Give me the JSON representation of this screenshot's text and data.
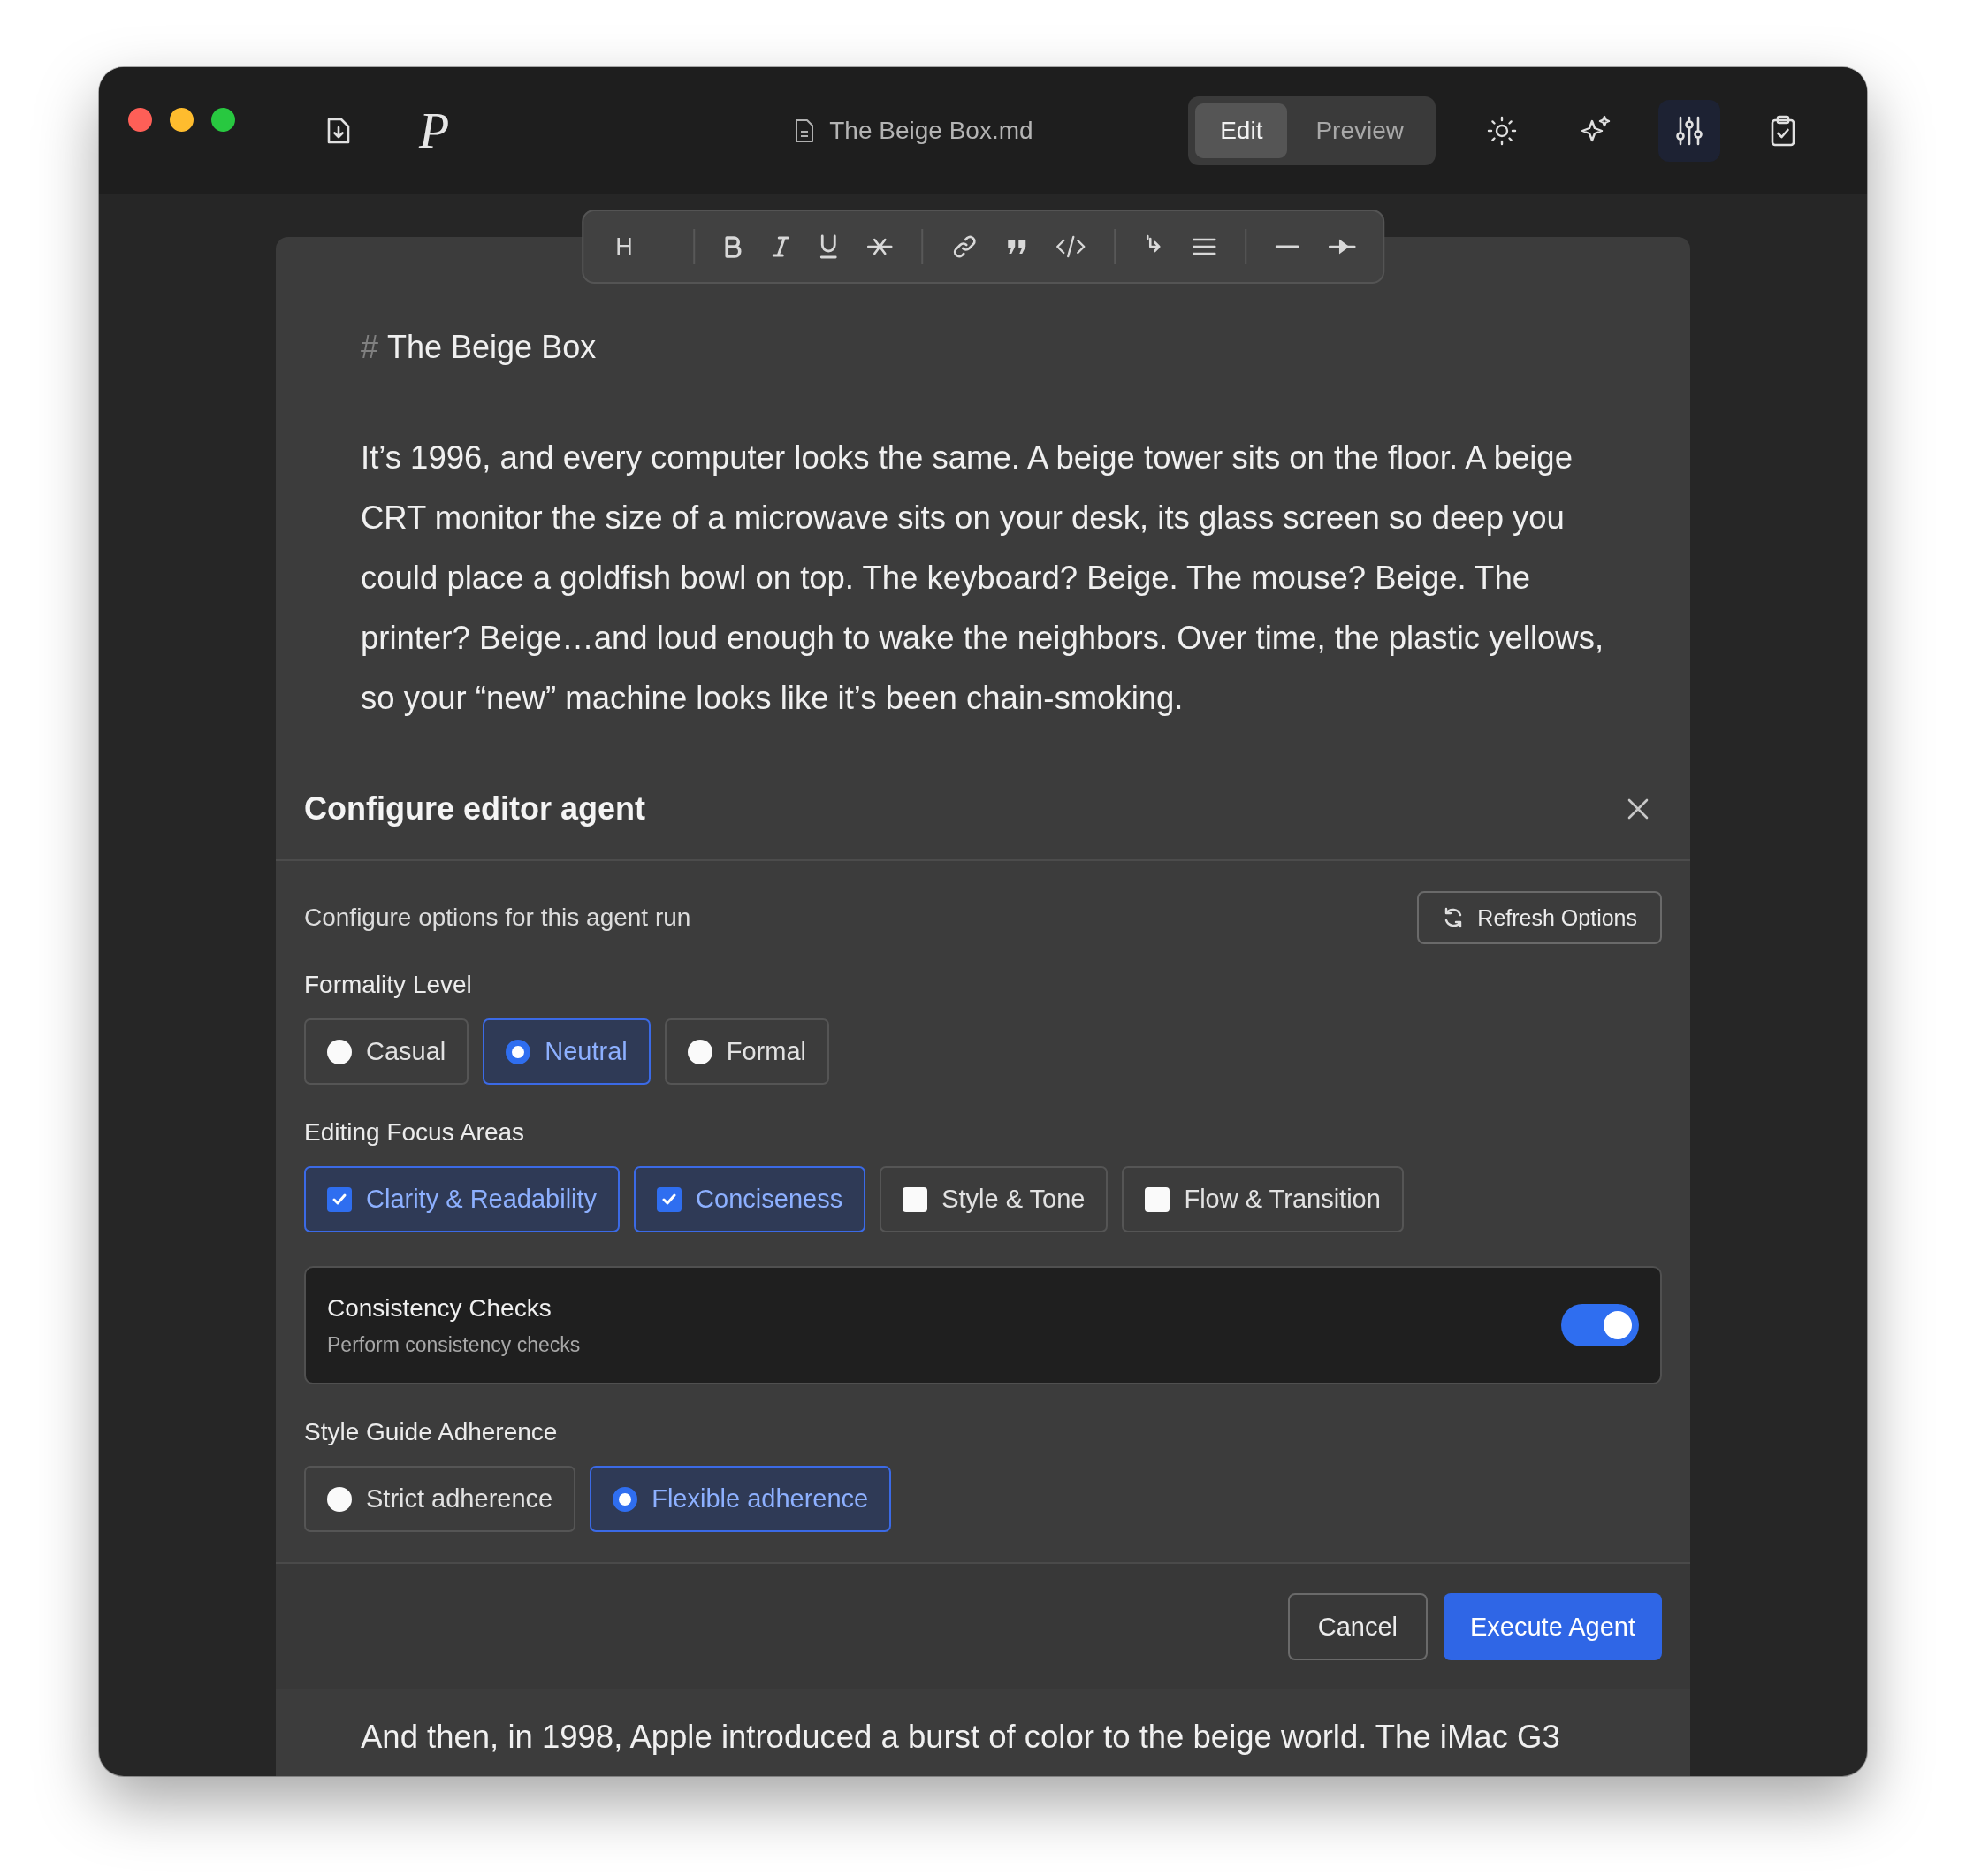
{
  "titlebar": {
    "logo": "P",
    "document_title": "The Beige Box.md",
    "modes": [
      {
        "label": "Edit",
        "selected": true
      },
      {
        "label": "Preview",
        "selected": false
      }
    ],
    "tools": [
      {
        "kind": "theme",
        "active": false
      },
      {
        "kind": "sparkle",
        "active": false
      },
      {
        "kind": "sliders",
        "active": true
      },
      {
        "kind": "clipboard",
        "active": false
      }
    ]
  },
  "format_toolbar": {
    "heading": "H"
  },
  "document": {
    "heading_marker": "#",
    "heading": "The Beige Box",
    "paragraph": "It’s 1996, and every computer looks the same. A beige tower sits on the floor. A beige CRT monitor the size of a microwave sits on your desk, its glass screen so deep you could place a goldfish bowl on top. The keyboard? Beige. The mouse? Beige. The printer? Beige…and loud enough to wake the neighbors. Over time, the plastic yellows, so your “new” machine looks like it’s been chain-smoking.",
    "next_paragraph": "And then, in 1998, Apple introduced a burst of color to the beige world. The iMac G3"
  },
  "dialog": {
    "title": "Configure editor agent",
    "description": "Configure options for this agent run",
    "refresh_button": "Refresh Options",
    "sections": [
      {
        "kind": "radio",
        "label": "Formality Level",
        "options": [
          {
            "label": "Casual",
            "selected": false
          },
          {
            "label": "Neutral",
            "selected": true
          },
          {
            "label": "Formal",
            "selected": false
          }
        ]
      },
      {
        "kind": "checkbox",
        "label": "Editing Focus Areas",
        "options": [
          {
            "label": "Clarity & Readability",
            "checked": true
          },
          {
            "label": "Conciseness",
            "checked": true
          },
          {
            "label": "Style & Tone",
            "checked": false
          },
          {
            "label": "Flow & Transition",
            "checked": false
          }
        ]
      },
      {
        "kind": "toggle",
        "title": "Consistency Checks",
        "subtitle": "Perform consistency checks",
        "on": true
      },
      {
        "kind": "radio",
        "label": "Style Guide Adherence",
        "options": [
          {
            "label": "Strict adherence",
            "selected": false
          },
          {
            "label": "Flexible adherence",
            "selected": true
          }
        ]
      }
    ],
    "cancel_button": "Cancel",
    "execute_button": "Execute Agent"
  }
}
